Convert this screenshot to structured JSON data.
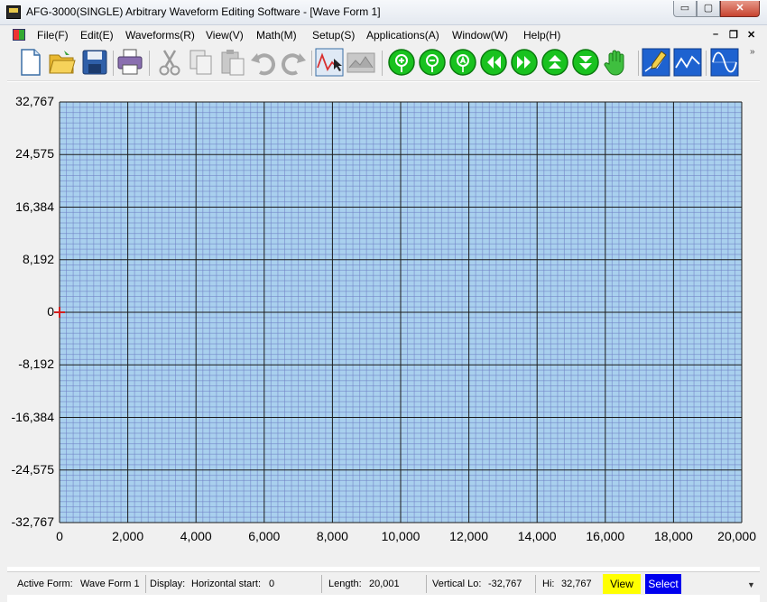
{
  "window": {
    "title": "AFG-3000(SINGLE) Arbitrary Waveform Editing Software  - [Wave Form 1]",
    "minimize_glyph": "▭",
    "maximize_glyph": "▢",
    "close_glyph": "✕"
  },
  "menu": {
    "items": [
      "File(F)",
      "Edit(E)",
      "Waveforms(R)",
      "View(V)",
      "Math(M)",
      "Setup(S)",
      "Applications(A)",
      "Window(W)",
      "Help(H)"
    ],
    "mdi_minimize": "–",
    "mdi_restore": "❐",
    "mdi_close": "✕"
  },
  "toolbar": {
    "icons": [
      "new-file-icon",
      "open-folder-icon",
      "save-disk-icon",
      "print-icon",
      "cut-icon",
      "copy-icon",
      "paste-icon",
      "undo-icon",
      "redo-icon",
      "cursor-wave-icon",
      "image-wave-icon",
      "zoom-in-icon",
      "zoom-out-icon",
      "zoom-auto-icon",
      "scroll-left-icon",
      "scroll-right-icon",
      "scroll-up-icon",
      "scroll-down-icon",
      "hand-pan-icon",
      "pen-draw-icon",
      "point-draw-icon",
      "sine-wave-icon"
    ],
    "more_glyph": "»"
  },
  "chart_data": {
    "type": "line",
    "title": "",
    "xlabel": "",
    "ylabel": "",
    "xlim": [
      0,
      20000
    ],
    "ylim": [
      -32767,
      32767
    ],
    "x_ticks": [
      "0",
      "2,000",
      "4,000",
      "6,000",
      "8,000",
      "10,000",
      "12,000",
      "14,000",
      "16,000",
      "18,000",
      "20,000"
    ],
    "y_ticks": [
      "32,767",
      "24,575",
      "16,384",
      "8,192",
      "0",
      "-8,192",
      "-16,384",
      "-24,575",
      "-32,767"
    ],
    "grid": true,
    "background_color": "#a9d0ee",
    "minor_grid_color": "#6f7fc4",
    "major_grid_color": "#1a1a1a",
    "cursor_marker": {
      "x": 0,
      "y": 0,
      "color": "#d42020"
    },
    "series": []
  },
  "status": {
    "active_form_label": "Active Form:",
    "active_form_value": "Wave Form 1",
    "display_label": "Display:",
    "horizontal_start_label": "Horizontal start:",
    "horizontal_start_value": "0",
    "length_label": "Length:",
    "length_value": "20,001",
    "vertical_lo_label": "Vertical Lo:",
    "vertical_lo_value": "-32,767",
    "hi_label": "Hi:",
    "hi_value": "32,767",
    "view_button": "View",
    "select_button": "Select",
    "dropdown_glyph": "▼"
  }
}
